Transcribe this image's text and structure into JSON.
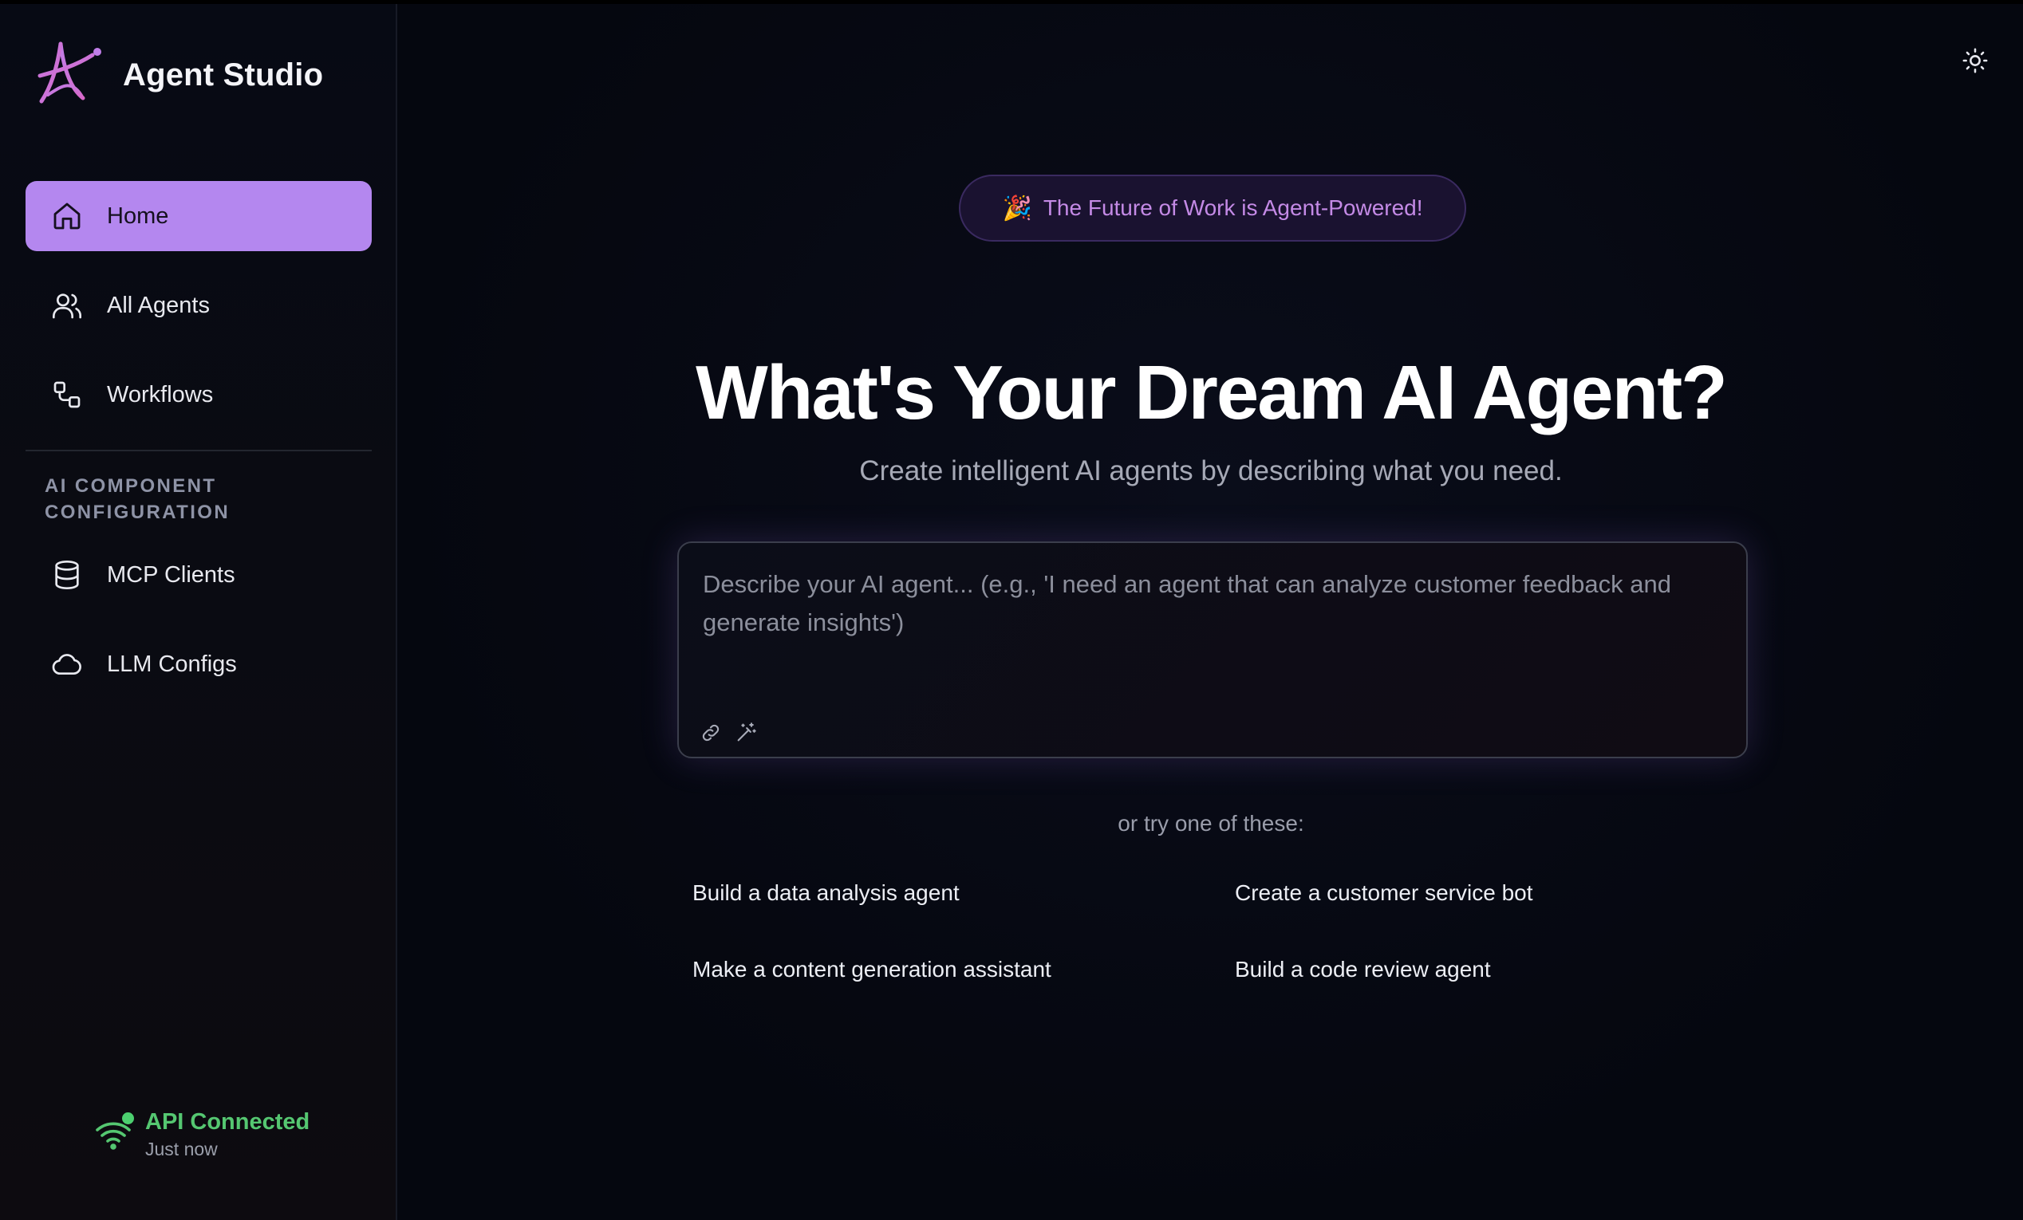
{
  "brand": {
    "title": "Agent Studio",
    "accent": "#b487ef"
  },
  "sidebar": {
    "items": [
      {
        "label": "Home",
        "icon": "home-icon",
        "active": true
      },
      {
        "label": "All Agents",
        "icon": "users-icon",
        "active": false
      },
      {
        "label": "Workflows",
        "icon": "workflow-icon",
        "active": false
      }
    ],
    "section_label": "AI COMPONENT CONFIGURATION",
    "config_items": [
      {
        "label": "MCP Clients",
        "icon": "database-icon"
      },
      {
        "label": "LLM Configs",
        "icon": "cloud-icon"
      }
    ],
    "status": {
      "label": "API Connected",
      "time": "Just now",
      "color": "#55c771",
      "icon": "wifi-icon"
    }
  },
  "header": {
    "theme_toggle_icon": "sun-icon"
  },
  "main": {
    "banner": {
      "emoji": "🎉",
      "text": "The Future of Work is Agent-Powered!"
    },
    "headline": "What's Your Dream AI Agent?",
    "subheadline": "Create intelligent AI agents by describing what you need.",
    "prompt": {
      "placeholder": "Describe your AI agent... (e.g., 'I need an agent that can analyze customer feedback and generate insights')",
      "value": "",
      "tools": [
        "link-icon",
        "magic-wand-icon"
      ]
    },
    "try_label": "or try one of these:",
    "suggestions": [
      "Build a data analysis agent",
      "Create a customer service bot",
      "Make a content generation assistant",
      "Build a code review agent"
    ]
  }
}
